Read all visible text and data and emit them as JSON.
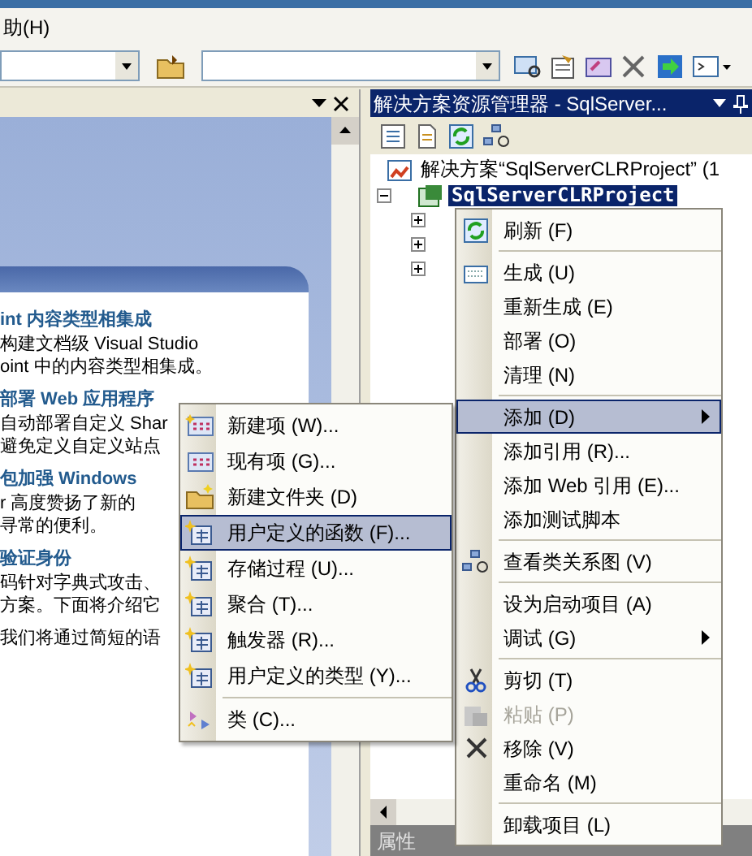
{
  "menu_bar": [
    {
      "label": "助(H)"
    }
  ],
  "document_pane": {
    "sections": [
      {
        "heading": "int 内容类型相集成",
        "lines": [
          "构建文档级 Visual Studio",
          "oint 中的内容类型相集成。"
        ]
      },
      {
        "heading": "部署 Web 应用程序",
        "lines": [
          "自动部署自定义 Shar",
          "避免定义自定义站点"
        ]
      },
      {
        "heading": "包加强 Windows",
        "lines": [
          "r 高度赞扬了新的",
          "寻常的便利。"
        ]
      },
      {
        "heading": "验证身份",
        "lines": [
          "码针对字典式攻击、",
          "方案。下面将介绍它"
        ]
      },
      {
        "lines": [
          "我们将通过简短的语"
        ]
      }
    ]
  },
  "solution_explorer": {
    "title": "解决方案资源管理器 - SqlServer...",
    "tree": [
      {
        "label": "解决方案“SqlServerCLRProject” (1",
        "selected": false
      },
      {
        "label": "SqlServerCLRProject",
        "selected": true,
        "expanded": true
      }
    ]
  },
  "properties_bar": {
    "title": "属性"
  },
  "context_menu": {
    "items": [
      {
        "kind": "item",
        "label": "刷新 (F)",
        "selected": false,
        "disabled": false
      },
      {
        "kind": "separator"
      },
      {
        "kind": "item",
        "label": "生成 (U)",
        "selected": false,
        "disabled": false
      },
      {
        "kind": "item",
        "label": "重新生成 (E)",
        "selected": false,
        "disabled": false
      },
      {
        "kind": "item",
        "label": "部署 (O)",
        "selected": false,
        "disabled": false
      },
      {
        "kind": "item",
        "label": "清理 (N)",
        "selected": false,
        "disabled": false
      },
      {
        "kind": "separator"
      },
      {
        "kind": "submenu",
        "label": "添加 (D)",
        "selected": true,
        "disabled": false
      },
      {
        "kind": "item",
        "label": "添加引用 (R)...",
        "selected": false,
        "disabled": false
      },
      {
        "kind": "item",
        "label": "添加 Web 引用 (E)...",
        "selected": false,
        "disabled": false
      },
      {
        "kind": "item",
        "label": "添加测试脚本",
        "selected": false,
        "disabled": false
      },
      {
        "kind": "separator"
      },
      {
        "kind": "item",
        "label": "查看类关系图 (V)",
        "selected": false,
        "disabled": false
      },
      {
        "kind": "separator"
      },
      {
        "kind": "item",
        "label": "设为启动项目 (A)",
        "selected": false,
        "disabled": false
      },
      {
        "kind": "submenu",
        "label": "调试 (G)",
        "selected": false,
        "disabled": false
      },
      {
        "kind": "separator"
      },
      {
        "kind": "item",
        "label": "剪切 (T)",
        "selected": false,
        "disabled": false
      },
      {
        "kind": "item",
        "label": "粘贴 (P)",
        "selected": false,
        "disabled": true
      },
      {
        "kind": "item",
        "label": "移除 (V)",
        "selected": false,
        "disabled": false
      },
      {
        "kind": "item",
        "label": "重命名 (M)",
        "selected": false,
        "disabled": false
      },
      {
        "kind": "separator"
      },
      {
        "kind": "item",
        "label": "卸载项目 (L)",
        "selected": false,
        "disabled": false
      }
    ]
  },
  "add_submenu": {
    "items": [
      {
        "kind": "item",
        "label": "新建项 (W)...",
        "selected": false
      },
      {
        "kind": "item",
        "label": "现有项 (G)...",
        "selected": false
      },
      {
        "kind": "item",
        "label": "新建文件夹 (D)",
        "selected": false
      },
      {
        "kind": "item",
        "label": "用户定义的函数 (F)...",
        "selected": true
      },
      {
        "kind": "item",
        "label": "存储过程 (U)...",
        "selected": false
      },
      {
        "kind": "item",
        "label": "聚合 (T)...",
        "selected": false
      },
      {
        "kind": "item",
        "label": "触发器 (R)...",
        "selected": false
      },
      {
        "kind": "item",
        "label": "用户定义的类型 (Y)...",
        "selected": false
      },
      {
        "kind": "separator"
      },
      {
        "kind": "item",
        "label": "类 (C)...",
        "selected": false
      }
    ]
  }
}
